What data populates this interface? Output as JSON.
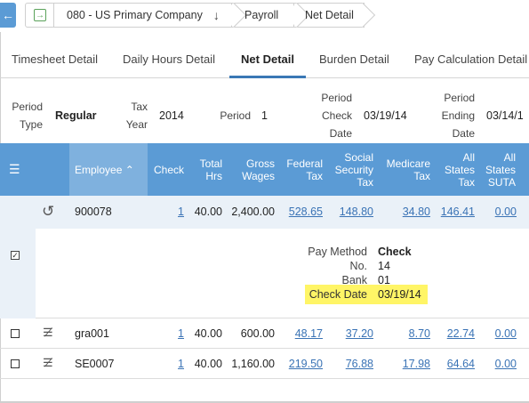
{
  "breadcrumb": {
    "back_icon": "back-arrow-icon",
    "home_icon": "go-to-icon",
    "company": "080 - US Primary Company",
    "company_icon": "arrow-down-icon",
    "payroll": "Payroll",
    "current": "Net Detail"
  },
  "tabs": [
    {
      "label": "Timesheet Detail"
    },
    {
      "label": "Daily Hours Detail"
    },
    {
      "label": "Net Detail",
      "active": true
    },
    {
      "label": "Burden Detail"
    },
    {
      "label": "Pay Calculation Detail"
    }
  ],
  "period": {
    "type_label_1": "Period",
    "type_label_2": "Type",
    "type_value": "Regular",
    "taxyear_label_1": "Tax",
    "taxyear_label_2": "Year",
    "taxyear_value": "2014",
    "period_label": "Period",
    "period_value": "1",
    "check_label_1": "Period",
    "check_label_2": "Check",
    "check_label_3": "Date",
    "check_value": "03/19/14",
    "ending_label_1": "Period",
    "ending_label_2": "Ending",
    "ending_label_3": "Date",
    "ending_value": "03/14/1"
  },
  "table": {
    "columns": {
      "employee": "Employee",
      "check": "Check",
      "total_hrs_1": "Total",
      "total_hrs_2": "Hrs",
      "gross_1": "Gross",
      "gross_2": "Wages",
      "federal_1": "Federal",
      "federal_2": "Tax",
      "ss_1": "Social",
      "ss_2": "Security",
      "ss_3": "Tax",
      "medicare_1": "Medicare",
      "medicare_2": "Tax",
      "allstates_1": "All",
      "allstates_2": "States",
      "allstates_3": "Tax",
      "suta_1": "All",
      "suta_2": "States",
      "suta_3": "SUTA"
    },
    "rows": [
      {
        "employee": "900078",
        "check": "1",
        "hrs": "40.00",
        "gross": "2,400.00",
        "federal": "528.65",
        "ss": "148.80",
        "medicare": "34.80",
        "states": "146.41",
        "suta": "0.00"
      },
      {
        "employee": "gra001",
        "check": "1",
        "hrs": "40.00",
        "gross": "600.00",
        "federal": "48.17",
        "ss": "37.20",
        "medicare": "8.70",
        "states": "22.74",
        "suta": "0.00"
      },
      {
        "employee": "SE0007",
        "check": "1",
        "hrs": "40.00",
        "gross": "1,160.00",
        "federal": "219.50",
        "ss": "76.88",
        "medicare": "17.98",
        "states": "64.64",
        "suta": "0.00"
      }
    ],
    "detail": {
      "pay_method_label": "Pay Method",
      "pay_method_value": "Check",
      "no_label": "No.",
      "no_value": "14",
      "bank_label": "Bank",
      "bank_value": "01",
      "check_date_label": "Check Date",
      "check_date_value": "03/19/14",
      "highlight_color": "#fff566"
    }
  },
  "colors": {
    "header": "#5b9bd5",
    "header_sorted": "#7fb1de",
    "link": "#3a73b5",
    "expanded_row": "#eaf1f8"
  }
}
